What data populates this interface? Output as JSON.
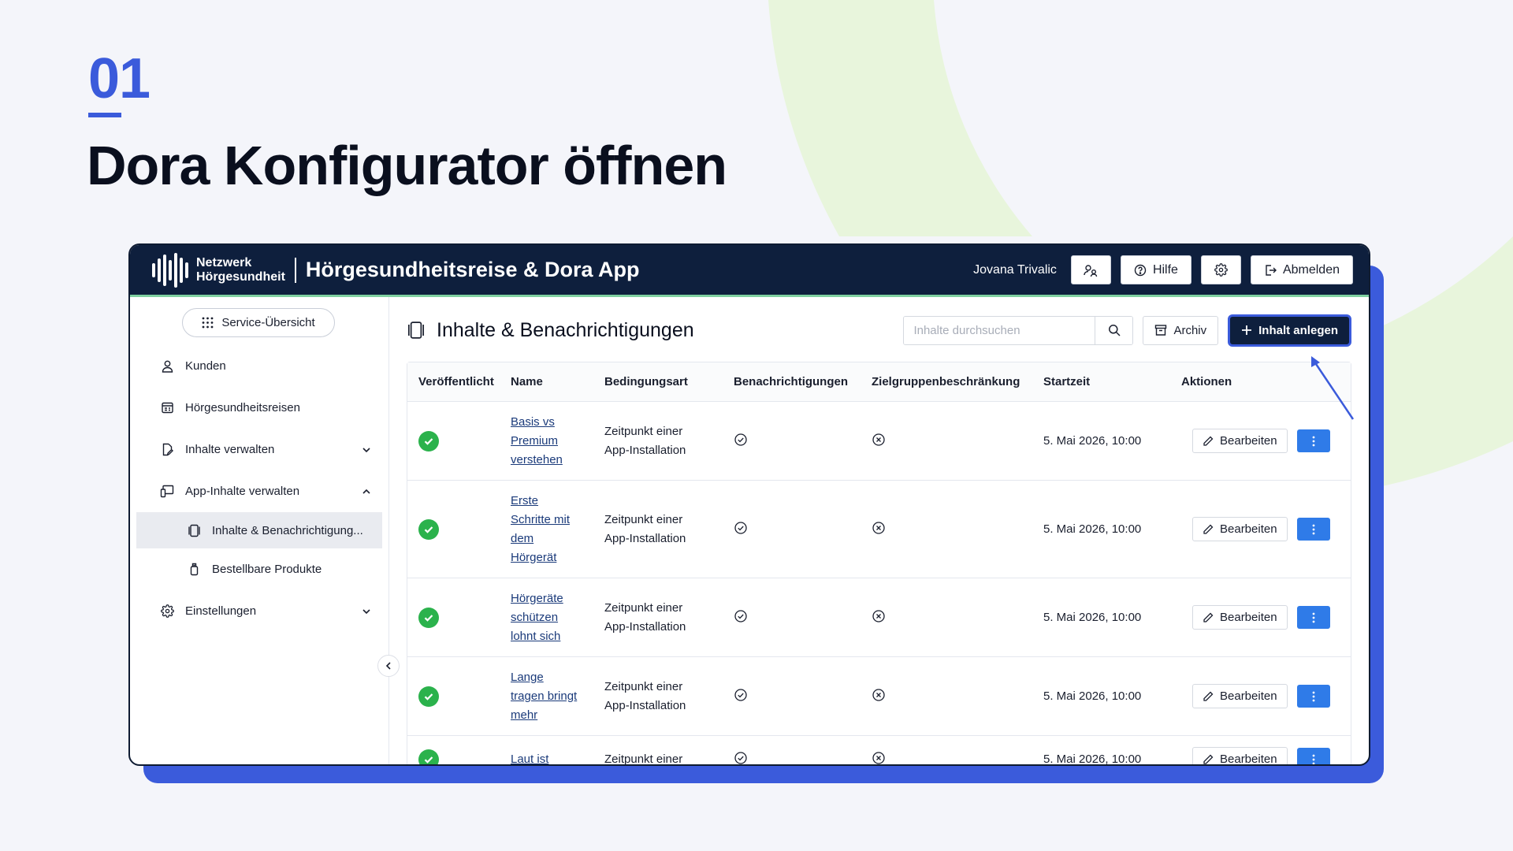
{
  "slide": {
    "step_number": "01",
    "title": "Dora Konfigurator öffnen"
  },
  "header": {
    "brand_line1": "Netzwerk",
    "brand_line2": "Hörgesundheit",
    "app_title": "Hörgesundheitsreise & Dora App",
    "user_name": "Jovana Trivalic",
    "help_label": "Hilfe",
    "logout_label": "Abmelden"
  },
  "sidebar": {
    "service_overview": "Service-Übersicht",
    "items": [
      {
        "label": "Kunden",
        "icon": "user-icon"
      },
      {
        "label": "Hörgesundheitsreisen",
        "icon": "journey-icon"
      },
      {
        "label": "Inhalte verwalten",
        "icon": "edit-doc-icon"
      },
      {
        "label": "App-Inhalte verwalten",
        "icon": "devices-icon"
      },
      {
        "label": "Inhalte & Benachrichtigung...",
        "icon": "pages-icon"
      },
      {
        "label": "Bestellbare Produkte",
        "icon": "bottle-icon"
      },
      {
        "label": "Einstellungen",
        "icon": "gear-icon"
      }
    ]
  },
  "main": {
    "title": "Inhalte & Benachrichtigungen",
    "search_placeholder": "Inhalte durchsuchen",
    "archive_label": "Archiv",
    "create_label": "Inhalt anlegen"
  },
  "table": {
    "columns": [
      "Veröffentlicht",
      "Name",
      "Bedingungsart",
      "Benachrichtigungen",
      "Zielgruppenbeschränkung",
      "Startzeit",
      "Aktionen"
    ],
    "rows": [
      {
        "name_lines": [
          "Basis vs",
          "Premium",
          "verstehen"
        ],
        "condition_lines": [
          "Zeitpunkt einer",
          "App-Installation"
        ],
        "start": "5. Mai 2026, 10:00",
        "edit": "Bearbeiten"
      },
      {
        "name_lines": [
          "Erste",
          "Schritte mit",
          "dem",
          "Hörgerät"
        ],
        "condition_lines": [
          "Zeitpunkt einer",
          "App-Installation"
        ],
        "start": "5. Mai 2026, 10:00",
        "edit": "Bearbeiten"
      },
      {
        "name_lines": [
          "Hörgeräte",
          "schützen",
          "lohnt sich"
        ],
        "condition_lines": [
          "Zeitpunkt einer",
          "App-Installation"
        ],
        "start": "5. Mai 2026, 10:00",
        "edit": "Bearbeiten"
      },
      {
        "name_lines": [
          "Lange",
          "tragen bringt",
          "mehr"
        ],
        "condition_lines": [
          "Zeitpunkt einer",
          "App-Installation"
        ],
        "start": "5. Mai 2026, 10:00",
        "edit": "Bearbeiten"
      },
      {
        "name_lines": [
          "Laut ist"
        ],
        "condition_lines": [
          "Zeitpunkt einer"
        ],
        "start": "5. Mai 2026, 10:00",
        "edit": "Bearbeiten"
      }
    ]
  },
  "colors": {
    "accent": "#3b5bdb",
    "navy": "#0e1f3d",
    "success": "#2bb24c",
    "primary_button": "#2f7be8",
    "deco_green": "#e8f5dc"
  }
}
